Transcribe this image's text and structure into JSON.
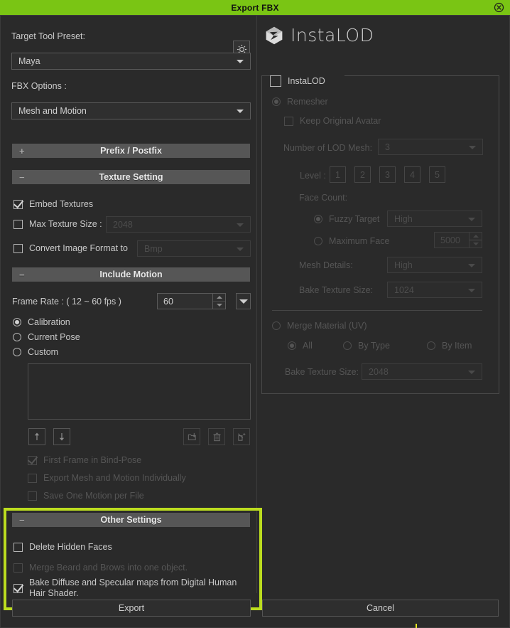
{
  "window": {
    "title": "Export FBX",
    "close_icon": "close-circle-icon",
    "accent_green": "#7ac514",
    "highlight_green": "#bcdd1f",
    "background": "#2a2a2a"
  },
  "left_panel": {
    "target_tool_preset_label": "Target Tool Preset:",
    "gear_icon": "gear-sun-icon",
    "preset_value": "Maya",
    "fbx_options_label": "FBX Options :",
    "fbx_options_value": "Mesh and Motion",
    "sections": {
      "prefix_postfix": {
        "label": "Prefix / Postfix",
        "toggle": "+"
      },
      "texture_setting": {
        "label": "Texture Setting",
        "toggle": "−"
      },
      "include_motion": {
        "label": "Include Motion",
        "toggle": "−"
      },
      "other_settings": {
        "label": "Other Settings",
        "toggle": "−"
      }
    },
    "texture_setting": {
      "embed_textures": {
        "label": "Embed Textures",
        "checked": true,
        "enabled": true
      },
      "max_texture_size": {
        "label": "Max Texture Size :",
        "checked": false,
        "enabled": true,
        "value": "2048"
      },
      "convert_image_format": {
        "label": "Convert Image Format to",
        "checked": false,
        "enabled": true,
        "value": "Bmp"
      }
    },
    "include_motion": {
      "frame_rate_label": "Frame Rate : ( 12 ~ 60 fps )",
      "frame_rate_value": "60",
      "motion_source_options": [
        "Calibration",
        "Current Pose",
        "Custom"
      ],
      "motion_source_selected": "Calibration",
      "list_items": [],
      "toolbar_icons": [
        "arrow-up-icon",
        "arrow-down-icon",
        "load-folder-icon",
        "trash-icon",
        "add-motion-icon"
      ],
      "first_frame_bind_pose": {
        "label": "First Frame in Bind-Pose",
        "checked": true,
        "enabled": false
      },
      "export_mesh_motion_individually": {
        "label": "Export Mesh and Motion Individually",
        "checked": false,
        "enabled": false
      },
      "save_one_motion_per_file": {
        "label": "Save One Motion per File",
        "checked": false,
        "enabled": false
      }
    },
    "other_settings": {
      "delete_hidden_faces": {
        "label": "Delete Hidden Faces",
        "checked": false,
        "enabled": true
      },
      "merge_beard_brows": {
        "label": "Merge Beard and Brows into one object.",
        "checked": false,
        "enabled": false
      },
      "bake_diffuse_specular": {
        "label": "Bake Diffuse and Specular maps from Digital Human Hair Shader.",
        "checked": true,
        "enabled": true
      }
    }
  },
  "right_panel": {
    "logo_text": "InstaLOD",
    "logo_icon": "instalod-cube-icon",
    "group_label": "InstaLOD",
    "group_enabled": false,
    "remesher": {
      "label": "Remesher",
      "selected": true,
      "enabled": false
    },
    "keep_original_avatar": {
      "label": "Keep Original Avatar",
      "checked": false,
      "enabled": false
    },
    "number_of_lod_mesh": {
      "label": "Number of LOD Mesh:",
      "value": "3"
    },
    "level": {
      "label": "Level :",
      "buttons": [
        "1",
        "2",
        "3",
        "4",
        "5"
      ],
      "selected": "1"
    },
    "face_count_label": "Face Count:",
    "fuzzy_target": {
      "label": "Fuzzy Target",
      "selected": true,
      "value": "High"
    },
    "maximum_face": {
      "label": "Maximum Face",
      "selected": false,
      "value": "5000"
    },
    "mesh_details": {
      "label": "Mesh Details:",
      "value": "High"
    },
    "bake_texture_size_remesher": {
      "label": "Bake Texture Size:",
      "value": "1024"
    },
    "merge_material_uv": {
      "label": "Merge Material (UV)",
      "selected": false
    },
    "merge_scope": {
      "options": [
        "All",
        "By Type",
        "By Item"
      ],
      "selected": "All"
    },
    "bake_texture_size_merge": {
      "label": "Bake Texture Size:",
      "value": "2048"
    }
  },
  "footer": {
    "export_label": "Export",
    "cancel_label": "Cancel"
  }
}
